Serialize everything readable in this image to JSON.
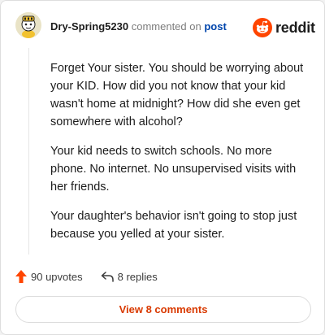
{
  "comment": {
    "author": "Dry-Spring5230",
    "action_text": "commented on",
    "post_link": "post",
    "paragraphs": [
      "Forget Your sister. You should be worrying about your KID. How did you not know that your kid wasn't home at midnight? How did she even get somewhere with alcohol?",
      "Your kid needs to switch schools. No more phone. No internet. No unsupervised visits with her friends.",
      "Your daughter's behavior isn't going to stop just because you yelled at your sister."
    ]
  },
  "brand": {
    "name": "reddit",
    "color": "#ff4500"
  },
  "actions": {
    "upvotes": "90 upvotes",
    "replies": "8 replies"
  },
  "view_button": {
    "label": "View 8 comments"
  },
  "icons": [
    "avatar",
    "reddit-logo-icon",
    "upvote-icon",
    "reply-icon"
  ]
}
